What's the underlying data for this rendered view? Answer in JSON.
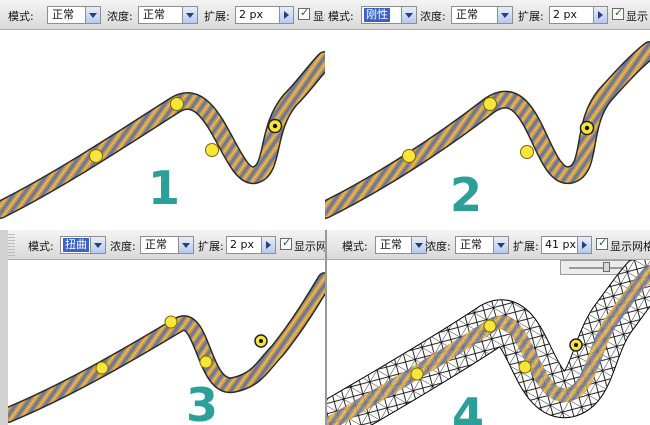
{
  "labels": {
    "mode": "模式:",
    "density": "浓度:",
    "expansion": "扩展:",
    "show_mesh": "显示网格"
  },
  "panels": [
    {
      "mode_value": "正常",
      "density_value": "正常",
      "expansion_value": "2 px",
      "show_mesh_visible": "显示",
      "number": "1",
      "mesh_visible": false,
      "mode_highlighted": false
    },
    {
      "mode_value": "刚性",
      "density_value": "正常",
      "expansion_value": "2 px",
      "show_mesh_visible": "显示",
      "number": "2",
      "mesh_visible": false,
      "mode_highlighted": true
    },
    {
      "mode_value": "扭曲",
      "density_value": "正常",
      "expansion_value": "2 px",
      "show_mesh_visible": "显示网",
      "number": "3",
      "mesh_visible": false,
      "mode_highlighted": true
    },
    {
      "mode_value": "正常",
      "density_value": "正常",
      "expansion_value": "41 px",
      "show_mesh_visible": "显示网格",
      "number": "4",
      "mesh_visible": true,
      "mode_highlighted": false
    }
  ],
  "slider_level_fraction": 0.5,
  "colors": {
    "pin": "#f7e53a",
    "number": "#2b9f98",
    "mesh": "#000000",
    "rope_light": "#d7b15a",
    "rope_dark": "#5a6a9a",
    "highlight": "#3a62c9"
  }
}
